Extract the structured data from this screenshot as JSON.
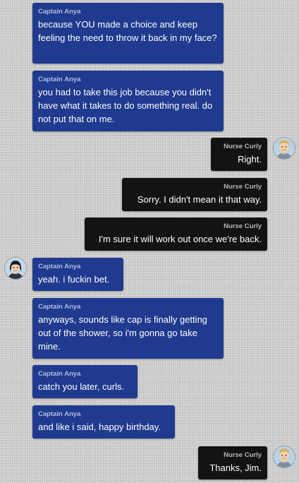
{
  "chat": {
    "messages": [
      {
        "sender": "Captain Anya",
        "text": "because YOU made a choice and keep feeling the need to throw it back in my face?"
      },
      {
        "sender": "Captain Anya",
        "text": "you had to take this job because you didn't have what it takes to do something real. do not put that on me."
      },
      {
        "sender": "Nurse Curly",
        "text": "Right."
      },
      {
        "sender": "Nurse Curly",
        "text": "Sorry. I didn't mean it that way."
      },
      {
        "sender": "Nurse Curly",
        "text": "I'm sure it will work out once we're back."
      },
      {
        "sender": "Captain Anya",
        "text": "yeah. i fuckin bet."
      },
      {
        "sender": "Captain Anya",
        "text": "anyways, sounds like cap is finally getting out of the shower, so i'm gonna go take mine."
      },
      {
        "sender": "Captain Anya",
        "text": "catch you later, curls."
      },
      {
        "sender": "Captain Anya",
        "text": "and like i said, happy birthday."
      },
      {
        "sender": "Nurse Curly",
        "text": "Thanks, Jim."
      }
    ]
  },
  "colors": {
    "anya_bubble": "#1f3a8e",
    "curly_bubble": "#131315",
    "background": "#c9c9c9"
  },
  "icons": {
    "curly_avatar": "blond-man-portrait-avatar",
    "anya_avatar": "dark-haired-woman-portrait-avatar"
  }
}
